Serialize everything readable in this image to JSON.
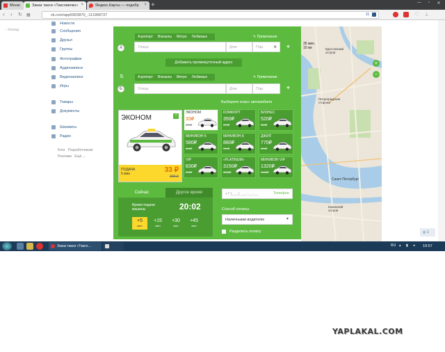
{
  "browser": {
    "tabs": [
      {
        "label": "Меню"
      },
      {
        "label": "Заказ такси «Таксовичко»"
      },
      {
        "label": "Яндекс.Карты — подобр"
      }
    ],
    "url": "vk.com/app5903870_-111968737",
    "badge": "11"
  },
  "sidebar": {
    "back_label": "Назад",
    "items": [
      {
        "label": "Новости",
        "icon": "news-icon"
      },
      {
        "label": "Сообщения",
        "icon": "messages-icon"
      },
      {
        "label": "Друзья",
        "icon": "friends-icon"
      },
      {
        "label": "Группы",
        "icon": "groups-icon"
      },
      {
        "label": "Фотографии",
        "icon": "photo-icon"
      },
      {
        "label": "Аудиозаписи",
        "icon": "audio-icon"
      },
      {
        "label": "Видеозаписи",
        "icon": "video-icon"
      },
      {
        "label": "Игры",
        "icon": "games-icon"
      },
      {
        "label": "Товары",
        "icon": "goods-icon"
      },
      {
        "label": "Документы",
        "icon": "docs-icon"
      },
      {
        "label": "Шахматы",
        "icon": "chess-icon"
      },
      {
        "label": "Радио",
        "icon": "radio-icon"
      }
    ],
    "links": "Блог   Разработчикам\nРеклама   Ещё ⌄"
  },
  "order": {
    "shortcuts": [
      "Аэропорт",
      "Вокзалы",
      "Метро",
      "Любимые"
    ],
    "note_label": "Примечание",
    "point_a": {
      "letter": "А",
      "street_placeholder": "Улица",
      "house_placeholder": "Дом",
      "entrance_placeholder": "Пар."
    },
    "add_point_label": "Добавить промежуточный адрес",
    "point_b": {
      "letter": "Б",
      "street_placeholder": "Улица",
      "house_placeholder": "Дом",
      "entrance_placeholder": "Пар."
    },
    "class_title": "Выберите класс автомобиля",
    "selected": {
      "name": "ЭКОНОМ",
      "badge": "i",
      "pickup_label": "ПОДАЧА",
      "pickup_time": "5 мин",
      "price": "33 ₽",
      "old_price": "300 ₽"
    },
    "classes": [
      {
        "name": "ЭКОНОМ",
        "price": "33₽",
        "old": "300₽"
      },
      {
        "name": "КОМФОРТ",
        "price": "350₽",
        "old": "370₽"
      },
      {
        "name": "БИЗНЕС",
        "price": "520₽",
        "old": "550₽"
      },
      {
        "name": "МИНИВЭН 6",
        "price": "580₽",
        "old": "600₽"
      },
      {
        "name": "МИНИВЭН 8",
        "price": "880₽",
        "old": "920₽"
      },
      {
        "name": "ДЖИП",
        "price": "770₽",
        "old": "800₽"
      },
      {
        "name": "VIP",
        "price": "830₽",
        "old": "870₽"
      },
      {
        "name": "«PLATINUM»",
        "price": "3150₽",
        "old": "3200₽"
      },
      {
        "name": "МИНИВЭН VIP",
        "price": "1320₽",
        "old": "1400₽"
      }
    ],
    "time": {
      "now_label": "Сейчас",
      "other_label": "Другое время",
      "pickup_label": "Время подачи машины",
      "value": "20:02",
      "unit": "мин",
      "options": [
        "+5",
        "+15",
        "+30",
        "+45"
      ]
    },
    "phone_placeholder": "+7 (___) ___-__-__",
    "phone_label": "Телефон",
    "payment_label": "Способ оплаты",
    "payment_value": "Наличными водителю",
    "split_label": "Разделить оплату"
  },
  "map": {
    "eta": "35 мин.\n10 км",
    "district": "Петроградская\nсторона",
    "city": "Санкт-Петербург",
    "south": "Казанский\nостров",
    "island": "Крестовский\nостров"
  },
  "taskbar": {
    "items": [
      "Заказ такси «Таксо…",
      "Яндекс Карты"
    ],
    "lang": "RU",
    "clock": "19:57"
  },
  "watermark": "YAPLAKAL.COM",
  "colors": {
    "accent": "#5cbb3f",
    "accent_dark": "#4a9e31",
    "highlight": "#fcd72c"
  }
}
